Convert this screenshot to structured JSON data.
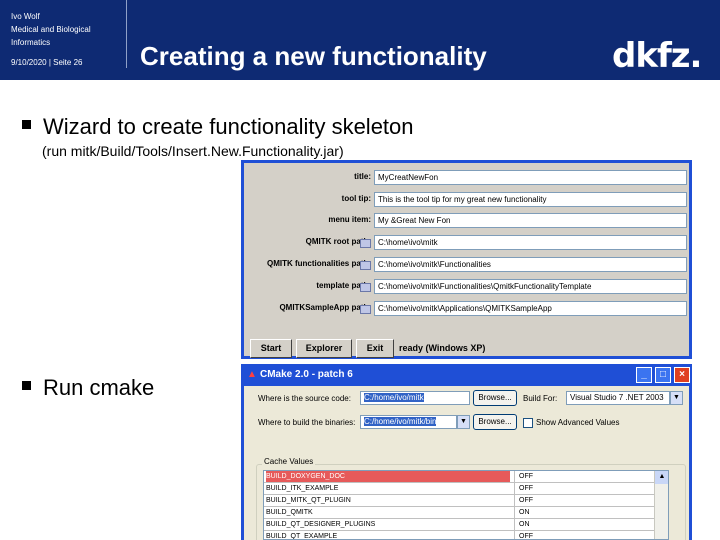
{
  "header": {
    "author": "Ivo Wolf",
    "dept_line1": "Medical and Biological",
    "dept_line2": "Informatics",
    "date_page": "9/10/2020 | Seite 26",
    "title": "Creating a new functionality",
    "logo": "dkfz."
  },
  "bullets": {
    "first": "Wizard to create functionality skeleton",
    "first_sub": "(run mitk/Build/Tools/Insert.New.Functionality.jar)",
    "second": "Run cmake"
  },
  "wizard": {
    "fields": [
      {
        "label": "title:",
        "value": "MyCreatNewFon"
      },
      {
        "label": "tool tip:",
        "value": "This is the tool tip for my great new functionality"
      },
      {
        "label": "menu item:",
        "value": "My &Great New Fon"
      },
      {
        "label": "QMITK root path:",
        "value": "C:\\home\\ivo\\mitk"
      },
      {
        "label": "QMITK functionalities path:",
        "value": "C:\\home\\ivo\\mitk\\Functionalities"
      },
      {
        "label": "template path:",
        "value": "C:\\home\\ivo\\mitk\\Functionalities\\QmitkFunctionalityTemplate"
      },
      {
        "label": "QMITKSampleApp path:",
        "value": "C:\\home\\ivo\\mitk\\Applications\\QMITKSampleApp"
      }
    ],
    "buttons": {
      "start": "Start",
      "explorer": "Explorer",
      "exit": "Exit"
    },
    "status": "ready (Windows XP)"
  },
  "cmake": {
    "title": "CMake 2.0 - patch 6",
    "title_icon": "warning-triangle-icon",
    "window_buttons": {
      "minimize": "_",
      "maximize": "□",
      "close": "×"
    },
    "source_label": "Where is the source code:",
    "source_value": "C:/home/ivo/mitk",
    "binary_label": "Where to build the binaries:",
    "binary_value": "C:/home/ivo/mitk/bin",
    "browse": "Browse...",
    "build_for_label": "Build For:",
    "build_for_value": "Visual Studio 7 .NET 2003",
    "show_advanced": "Show Advanced Values",
    "cache_label": "Cache Values",
    "cache_rows": [
      {
        "key": "BUILD_DOXYGEN_DOC",
        "value": "OFF"
      },
      {
        "key": "BUILD_ITK_EXAMPLE",
        "value": "OFF"
      },
      {
        "key": "BUILD_MITK_QT_PLUGIN",
        "value": "OFF"
      },
      {
        "key": "BUILD_QMITK",
        "value": "ON"
      },
      {
        "key": "BUILD_QT_DESIGNER_PLUGINS",
        "value": "ON"
      },
      {
        "key": "BUILD_QT_EXAMPLE",
        "value": "OFF"
      }
    ]
  }
}
